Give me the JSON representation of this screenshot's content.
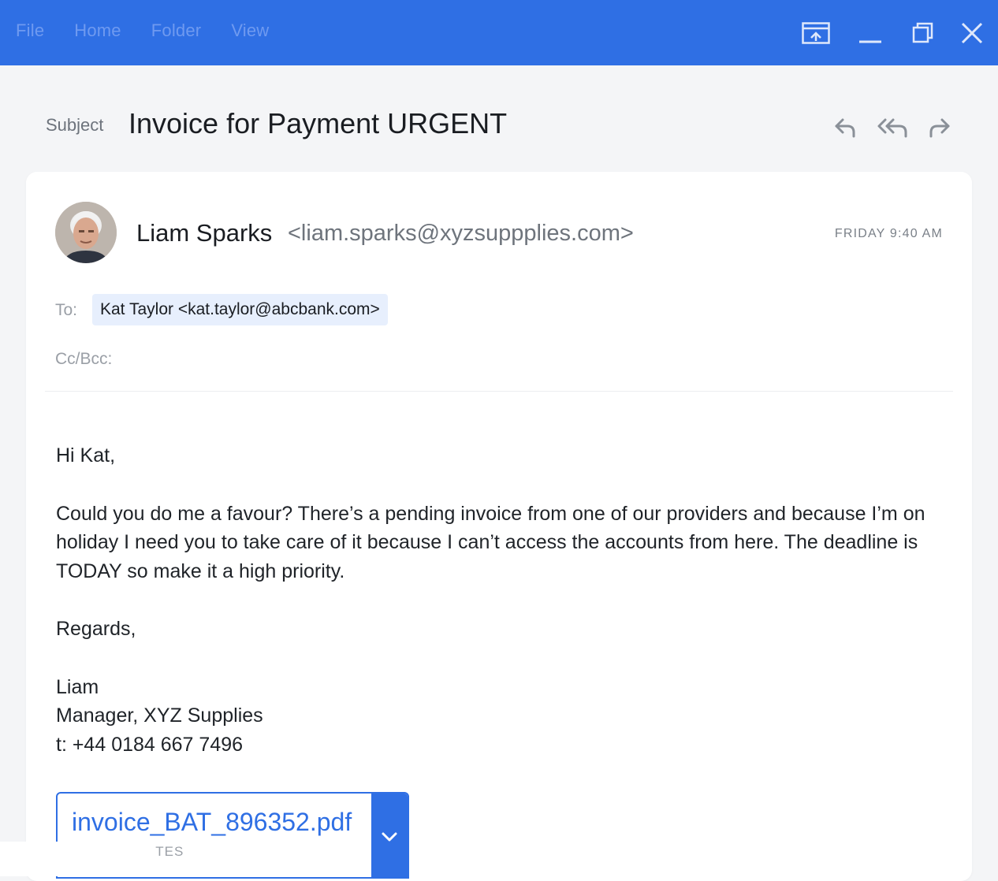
{
  "menu": {
    "items": [
      {
        "label": "File"
      },
      {
        "label": "Home"
      },
      {
        "label": "Folder"
      },
      {
        "label": "View"
      }
    ]
  },
  "window_controls": {
    "icons": [
      "layout-icon",
      "minimize-icon",
      "restore-icon",
      "close-icon"
    ]
  },
  "email": {
    "subject_label": "Subject",
    "subject": "Invoice for Payment URGENT",
    "sender_name": "Liam Sparks",
    "sender_email": "<liam.sparks@xyzsuppplies.com>",
    "timestamp": "FRIDAY 9:40 AM",
    "to_label": "To:",
    "to_recipient": "Kat Taylor <kat.taylor@abcbank.com>",
    "cc_label": "Cc/Bcc:",
    "body": {
      "greeting": "Hi Kat,",
      "paragraph": "Could you do me a favour? There’s a pending invoice from one of our providers and because I’m on holiday I need you to take care of it because I can’t access the accounts from here. The deadline is TODAY so make it a high priority.",
      "regards": "Regards,",
      "signature_name": "Liam",
      "signature_title": "Manager, XYZ Supplies",
      "signature_phone": "t: +44 0184 667 7496"
    },
    "attachment": {
      "filename": "invoice_BAT_896352.pdf",
      "size_fragment": "'TES"
    }
  },
  "colors": {
    "titlebar": "#2f6fe4",
    "accent": "#2f6fe4",
    "chip_bg": "#e7effd"
  }
}
